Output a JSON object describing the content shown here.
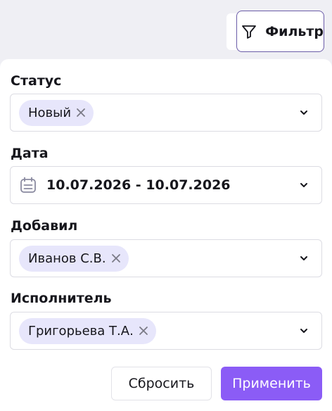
{
  "header": {
    "filter_button_label": "Фильтр"
  },
  "filters": {
    "status": {
      "label": "Статус",
      "chips": [
        "Новый"
      ]
    },
    "date": {
      "label": "Дата",
      "value": "10.07.2026 - 10.07.2026"
    },
    "added_by": {
      "label": "Добавил",
      "chips": [
        "Иванов С.В."
      ]
    },
    "assignee": {
      "label": "Исполнитель",
      "chips": [
        "Григорьева Т.А."
      ]
    }
  },
  "actions": {
    "reset_label": "Сбросить",
    "apply_label": "Применить"
  },
  "colors": {
    "accent": "#8b5cf6",
    "chip_bg": "#e7e6fb",
    "page_bg": "#efeff4",
    "filter_button_border": "#6b5ca8"
  },
  "icons": {
    "filter": "filter-funnel-icon",
    "calendar": "calendar-icon",
    "chevron": "chevron-down-icon",
    "remove": "close-icon"
  }
}
